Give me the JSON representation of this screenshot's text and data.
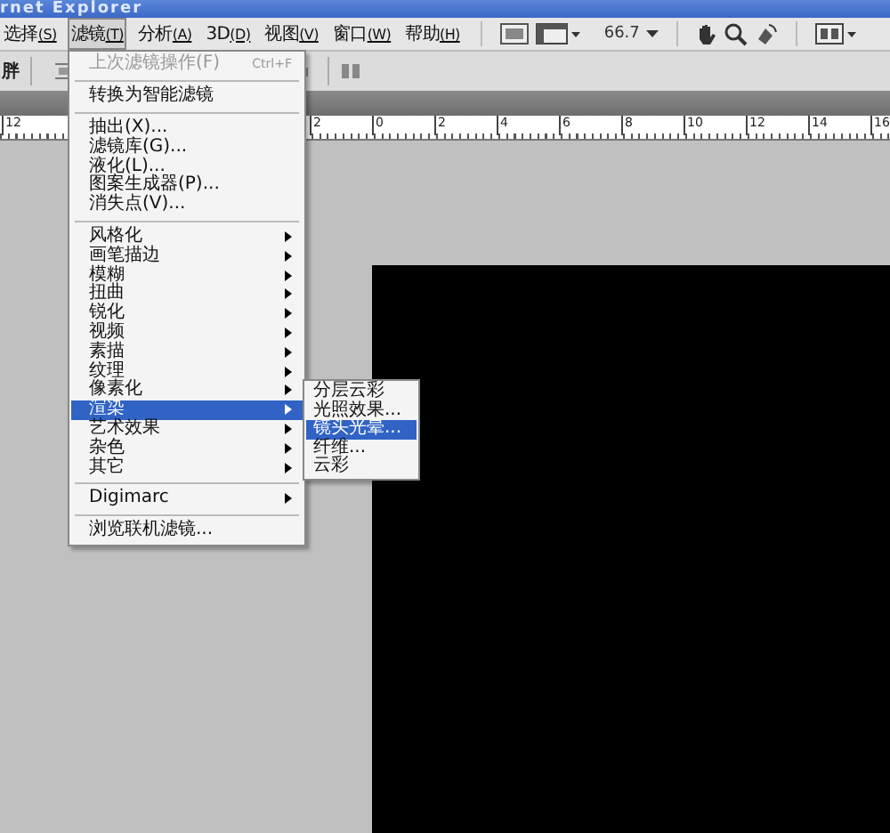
{
  "window": {
    "title": "rnet Explorer"
  },
  "menu_bar": {
    "items": [
      {
        "label": "选择",
        "mnemonic": "(S)",
        "selected": false
      },
      {
        "label": "滤镜",
        "mnemonic": "(T)",
        "selected": true
      },
      {
        "label": "分析",
        "mnemonic": "(A)",
        "selected": false
      },
      {
        "label": "3D",
        "mnemonic": "(D)",
        "selected": false
      },
      {
        "label": "视图",
        "mnemonic": "(V)",
        "selected": false
      },
      {
        "label": "窗口",
        "mnemonic": "(W)",
        "selected": false
      },
      {
        "label": "帮助",
        "mnemonic": "(H)",
        "selected": false
      }
    ],
    "zoom": "66.7"
  },
  "options_bar": {
    "label": "胖"
  },
  "ruler": {
    "labels": [
      "12",
      "2",
      "0",
      "2",
      "4",
      "6",
      "8",
      "10",
      "12",
      "14",
      "16"
    ]
  },
  "filter_menu": {
    "sections": [
      [
        {
          "label": "上次滤镜操作(F)",
          "shortcut": "Ctrl+F",
          "disabled": true,
          "submenu": false,
          "selected": false
        }
      ],
      [
        {
          "label": "转换为智能滤镜",
          "disabled": false,
          "submenu": false,
          "selected": false
        }
      ],
      [
        {
          "label": "抽出(X)...",
          "disabled": false,
          "submenu": false,
          "selected": false
        },
        {
          "label": "滤镜库(G)...",
          "disabled": false,
          "submenu": false,
          "selected": false
        },
        {
          "label": "液化(L)...",
          "disabled": false,
          "submenu": false,
          "selected": false
        },
        {
          "label": "图案生成器(P)...",
          "disabled": false,
          "submenu": false,
          "selected": false
        },
        {
          "label": "消失点(V)...",
          "disabled": false,
          "submenu": false,
          "selected": false
        }
      ],
      [
        {
          "label": "风格化",
          "disabled": false,
          "submenu": true,
          "selected": false
        },
        {
          "label": "画笔描边",
          "disabled": false,
          "submenu": true,
          "selected": false
        },
        {
          "label": "模糊",
          "disabled": false,
          "submenu": true,
          "selected": false
        },
        {
          "label": "扭曲",
          "disabled": false,
          "submenu": true,
          "selected": false
        },
        {
          "label": "锐化",
          "disabled": false,
          "submenu": true,
          "selected": false
        },
        {
          "label": "视频",
          "disabled": false,
          "submenu": true,
          "selected": false
        },
        {
          "label": "素描",
          "disabled": false,
          "submenu": true,
          "selected": false
        },
        {
          "label": "纹理",
          "disabled": false,
          "submenu": true,
          "selected": false
        },
        {
          "label": "像素化",
          "disabled": false,
          "submenu": true,
          "selected": false
        },
        {
          "label": "渲染",
          "disabled": false,
          "submenu": true,
          "selected": true
        },
        {
          "label": "艺术效果",
          "disabled": false,
          "submenu": true,
          "selected": false
        },
        {
          "label": "杂色",
          "disabled": false,
          "submenu": true,
          "selected": false
        },
        {
          "label": "其它",
          "disabled": false,
          "submenu": true,
          "selected": false
        }
      ],
      [
        {
          "label": "Digimarc",
          "disabled": false,
          "submenu": true,
          "selected": false
        }
      ],
      [
        {
          "label": "浏览联机滤镜...",
          "disabled": false,
          "submenu": false,
          "selected": false
        }
      ]
    ]
  },
  "render_submenu": {
    "items": [
      {
        "label": "分层云彩",
        "selected": false
      },
      {
        "label": "光照效果...",
        "selected": false
      },
      {
        "label": "镜头光晕...",
        "selected": true
      },
      {
        "label": "纤维...",
        "selected": false
      },
      {
        "label": "云彩",
        "selected": false
      }
    ]
  }
}
